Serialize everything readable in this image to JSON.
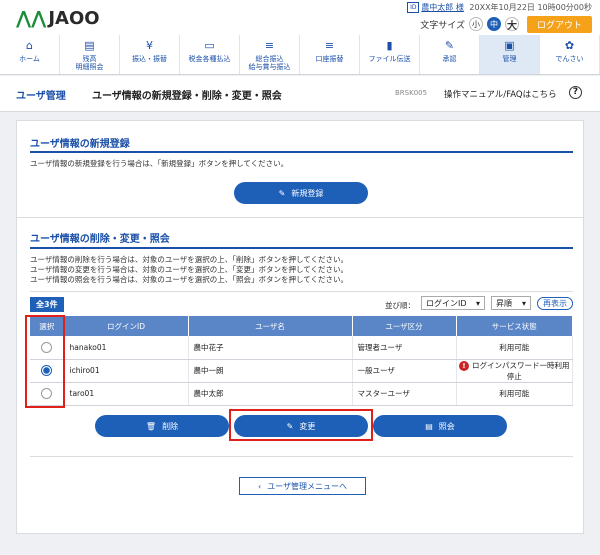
{
  "header": {
    "logo_text": "JAOO",
    "user_name": "農中太郎 様",
    "user_icon": "ID",
    "last_login": "20XX年10月22日 10時00分00秒",
    "font_size_label": "文字サイズ",
    "font_sizes": [
      "小",
      "中",
      "大"
    ],
    "logout_label": "ログアウト"
  },
  "nav": [
    {
      "label": "ホーム",
      "icon": "home-icon"
    },
    {
      "label": "残高\n明細照会",
      "icon": "document-icon"
    },
    {
      "label": "振込・振替",
      "icon": "yen-icon"
    },
    {
      "label": "税金各種払込",
      "icon": "card-icon"
    },
    {
      "label": "総合振込\n給与賞与振込",
      "icon": "coins-icon"
    },
    {
      "label": "口座振替",
      "icon": "coins-icon"
    },
    {
      "label": "ファイル伝送",
      "icon": "file-icon"
    },
    {
      "label": "承認",
      "icon": "approve-icon"
    },
    {
      "label": "管理",
      "icon": "admin-icon"
    },
    {
      "label": "でんさい",
      "icon": "densai-icon"
    }
  ],
  "page": {
    "breadcrumb": "ユーザ管理",
    "title": "ユーザ情報の新規登録・削除・変更・照会",
    "screen_code": "BRSK005",
    "manual_link": "操作マニュアル/FAQはこちら",
    "help_icon": "?"
  },
  "register": {
    "title": "ユーザ情報の新規登録",
    "desc": "ユーザ情報の新規登録を行う場合は、「新規登録」ボタンを押してください。",
    "button": "新規登録"
  },
  "manage": {
    "title": "ユーザ情報の削除・変更・照会",
    "desc1": "ユーザ情報の削除を行う場合は、対象のユーザを選択の上、「削除」ボタンを押してください。",
    "desc2": "ユーザ情報の変更を行う場合は、対象のユーザを選択の上、「変更」ボタンを押してください。",
    "desc3": "ユーザ情報の照会を行う場合は、対象のユーザを選択の上、「照会」ボタンを押してください。",
    "count": "全3件",
    "sort_label": "並び順：",
    "sort_key": "ログインID",
    "sort_order": "昇順",
    "redisplay": "再表示",
    "columns": [
      "選択",
      "ログインID",
      "ユーザ名",
      "ユーザ区分",
      "サービス状態"
    ],
    "rows": [
      {
        "login_id": "hanako01",
        "name": "農中花子",
        "type": "管理者ユーザ",
        "status": "利用可能",
        "selected": false
      },
      {
        "login_id": "ichiro01",
        "name": "農中一朗",
        "type": "一般ユーザ",
        "status": "ログインパスワード一時利用停止",
        "selected": true
      },
      {
        "login_id": "taro01",
        "name": "農中太郎",
        "type": "マスターユーザ",
        "status": "利用可能",
        "selected": false
      }
    ],
    "delete_button": "削除",
    "change_button": "変更",
    "inquiry_button": "照会",
    "back_button": "ユーザ管理メニューへ"
  }
}
